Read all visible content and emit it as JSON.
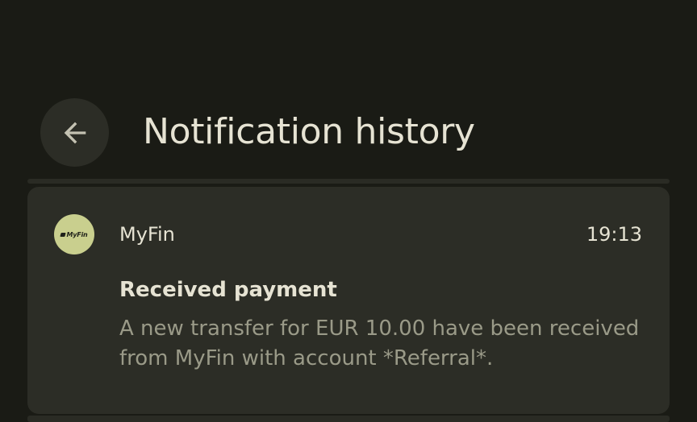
{
  "header": {
    "title": "Notification history",
    "back_icon": "arrow-back-icon"
  },
  "notification": {
    "app_logo_text": "MyFin",
    "app_name": "MyFin",
    "time": "19:13",
    "title": "Received payment",
    "body": "A new transfer for EUR 10.00 have been received from MyFin with account *Referral*."
  },
  "colors": {
    "background": "#1a1b15",
    "card": "#2c2d26",
    "text_primary": "#e6e3d3",
    "text_secondary": "#9a9a88",
    "avatar": "#c9cf8e"
  }
}
